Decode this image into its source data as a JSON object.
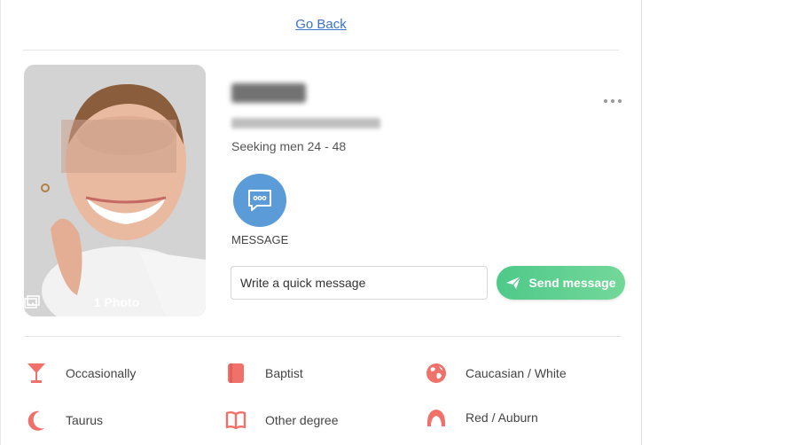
{
  "nav": {
    "back_label": "Go Back"
  },
  "profile": {
    "seeking": "Seeking men 24 - 48",
    "photo_count": "1 Photo"
  },
  "actions": {
    "message_label": "MESSAGE",
    "quick_message_placeholder": "Write a quick message",
    "send_label": "Send message"
  },
  "attributes": [
    {
      "icon": "cocktail-glass-icon",
      "label": "Occasionally"
    },
    {
      "icon": "book-icon",
      "label": "Baptist"
    },
    {
      "icon": "globe-icon",
      "label": "Caucasian / White"
    },
    {
      "icon": "crescent-moon-icon",
      "label": "Taurus"
    },
    {
      "icon": "open-book-icon",
      "label": "Other degree"
    },
    {
      "icon": "hair-icon",
      "label": "Red / Auburn"
    }
  ],
  "colors": {
    "accent_red": "#f0706a",
    "link_blue": "#3b73c9",
    "message_blue": "#5b9bd8",
    "send_green": "#4ec989"
  }
}
